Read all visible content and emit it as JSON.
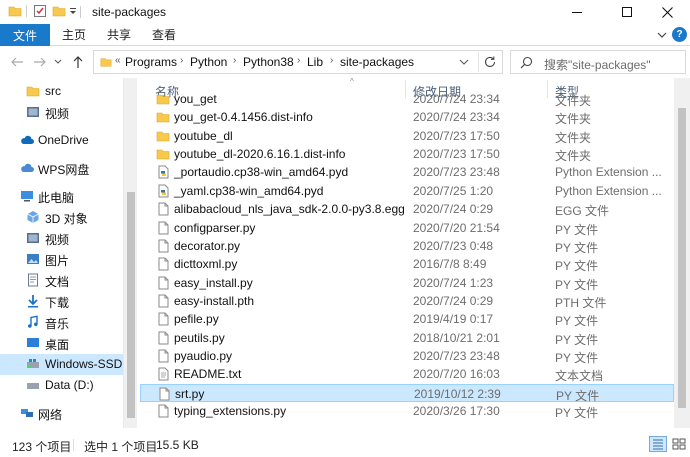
{
  "window": {
    "title": "site-packages"
  },
  "ribbon": {
    "tabs": [
      "文件",
      "主页",
      "共享",
      "查看"
    ]
  },
  "address": {
    "crumbs": [
      "Programs",
      "Python",
      "Python38",
      "Lib",
      "site-packages"
    ]
  },
  "search": {
    "placeholder": "搜索\"site-packages\""
  },
  "sidebar": {
    "items": [
      {
        "label": "src",
        "icon": "folder-icon"
      },
      {
        "label": "视频",
        "icon": "video-folder-icon"
      },
      {
        "label": "OneDrive",
        "icon": "cloud-icon"
      },
      {
        "label": "WPS网盘",
        "icon": "wps-cloud-icon"
      },
      {
        "label": "此电脑",
        "icon": "computer-icon"
      },
      {
        "label": "3D 对象",
        "icon": "3d-objects-icon"
      },
      {
        "label": "视频",
        "icon": "video-folder-icon"
      },
      {
        "label": "图片",
        "icon": "pictures-icon"
      },
      {
        "label": "文档",
        "icon": "documents-icon"
      },
      {
        "label": "下载",
        "icon": "download-icon"
      },
      {
        "label": "音乐",
        "icon": "music-icon"
      },
      {
        "label": "桌面",
        "icon": "desktop-icon"
      },
      {
        "label": "Windows-SSD (",
        "icon": "drive-c-icon"
      },
      {
        "label": "Data (D:)",
        "icon": "drive-icon"
      },
      {
        "label": "网络",
        "icon": "network-icon"
      }
    ]
  },
  "columns": {
    "name": "名称",
    "date": "修改日期",
    "type": "类型"
  },
  "files": [
    {
      "name": "you_get",
      "date": "2020/7/24 23:34",
      "type": "文件夹",
      "icon": "folder-icon"
    },
    {
      "name": "you_get-0.4.1456.dist-info",
      "date": "2020/7/24 23:34",
      "type": "文件夹",
      "icon": "folder-icon"
    },
    {
      "name": "youtube_dl",
      "date": "2020/7/23 17:50",
      "type": "文件夹",
      "icon": "folder-icon"
    },
    {
      "name": "youtube_dl-2020.6.16.1.dist-info",
      "date": "2020/7/23 17:50",
      "type": "文件夹",
      "icon": "folder-icon"
    },
    {
      "name": "_portaudio.cp38-win_amd64.pyd",
      "date": "2020/7/23 23:48",
      "type": "Python Extension ...",
      "icon": "python-file-icon"
    },
    {
      "name": "_yaml.cp38-win_amd64.pyd",
      "date": "2020/7/25 1:20",
      "type": "Python Extension ...",
      "icon": "python-file-icon"
    },
    {
      "name": "alibabacloud_nls_java_sdk-2.0.0-py3.8.egg",
      "date": "2020/7/24 0:29",
      "type": "EGG 文件",
      "icon": "file-icon"
    },
    {
      "name": "configparser.py",
      "date": "2020/7/20 21:54",
      "type": "PY 文件",
      "icon": "file-icon"
    },
    {
      "name": "decorator.py",
      "date": "2020/7/23 0:48",
      "type": "PY 文件",
      "icon": "file-icon"
    },
    {
      "name": "dicttoxml.py",
      "date": "2016/7/8 8:49",
      "type": "PY 文件",
      "icon": "file-icon"
    },
    {
      "name": "easy_install.py",
      "date": "2020/7/24 1:23",
      "type": "PY 文件",
      "icon": "file-icon"
    },
    {
      "name": "easy-install.pth",
      "date": "2020/7/24 0:29",
      "type": "PTH 文件",
      "icon": "file-icon"
    },
    {
      "name": "pefile.py",
      "date": "2019/4/19 0:17",
      "type": "PY 文件",
      "icon": "file-icon"
    },
    {
      "name": "peutils.py",
      "date": "2018/10/21 2:01",
      "type": "PY 文件",
      "icon": "file-icon"
    },
    {
      "name": "pyaudio.py",
      "date": "2020/7/23 23:48",
      "type": "PY 文件",
      "icon": "file-icon"
    },
    {
      "name": "README.txt",
      "date": "2020/7/20 16:03",
      "type": "文本文档",
      "icon": "text-file-icon"
    },
    {
      "name": "srt.py",
      "date": "2019/10/12 2:39",
      "type": "PY 文件",
      "icon": "file-icon"
    },
    {
      "name": "typing_extensions.py",
      "date": "2020/3/26 17:30",
      "type": "PY 文件",
      "icon": "file-icon"
    }
  ],
  "status": {
    "item_count": "123 个项目",
    "selected": "选中 1 个项目",
    "size": "15.5 KB"
  }
}
